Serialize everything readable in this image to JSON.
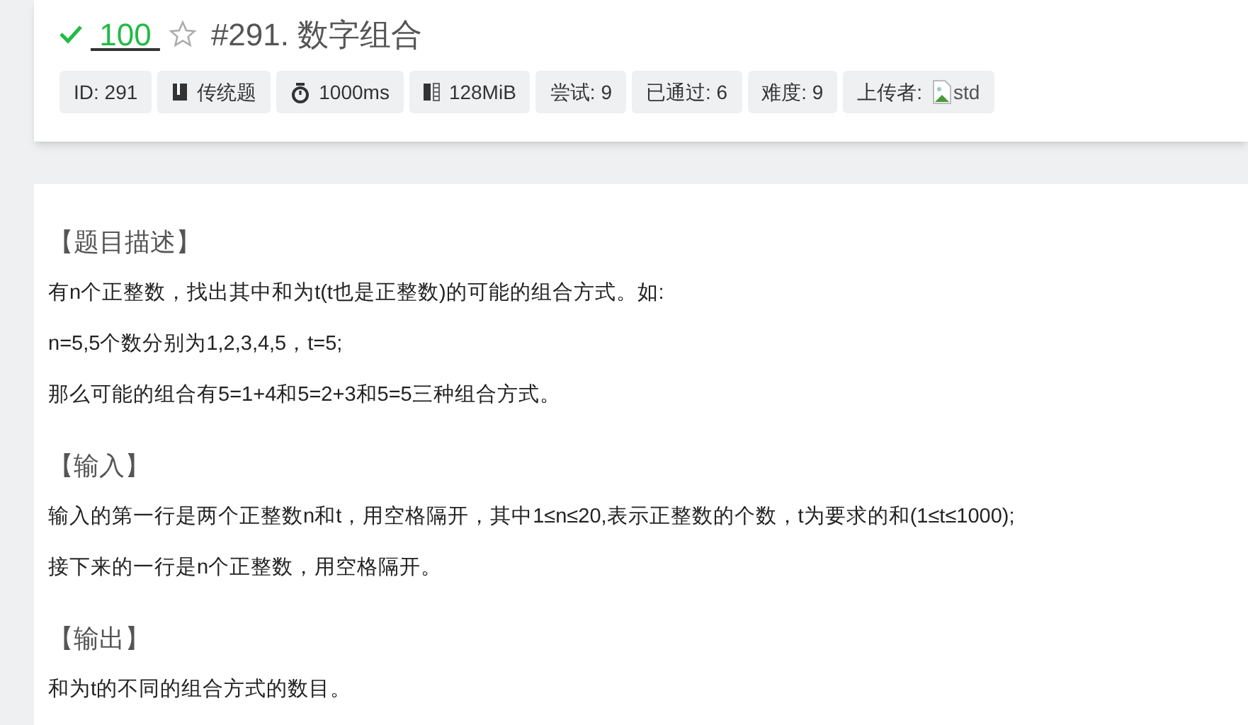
{
  "header": {
    "solved": true,
    "score": "100",
    "starred": false,
    "title": "#291. 数字组合"
  },
  "tags": [
    {
      "kind": "plain",
      "text": "ID: 291"
    },
    {
      "kind": "book",
      "text": "传统题"
    },
    {
      "kind": "timer",
      "text": "1000ms"
    },
    {
      "kind": "memory",
      "text": "128MiB"
    },
    {
      "kind": "plain",
      "text": "尝试: 9"
    },
    {
      "kind": "plain",
      "text": "已通过: 6"
    },
    {
      "kind": "plain",
      "text": "难度: 9"
    },
    {
      "kind": "uploader",
      "text": "上传者:",
      "user": "std"
    }
  ],
  "sections": [
    {
      "heading": "【题目描述】",
      "paragraphs": [
        "有n个正整数，找出其中和为t(t也是正整数)的可能的组合方式。如:",
        "n=5,5个数分别为1,2,3,4,5，t=5;",
        "那么可能的组合有5=1+4和5=2+3和5=5三种组合方式。"
      ]
    },
    {
      "heading": "【输入】",
      "paragraphs": [
        "输入的第一行是两个正整数n和t，用空格隔开，其中1≤n≤20,表示正整数的个数，t为要求的和(1≤t≤1000);",
        "接下来的一行是n个正整数，用空格隔开。"
      ]
    },
    {
      "heading": "【输出】",
      "paragraphs": [
        "和为t的不同的组合方式的数目。"
      ]
    }
  ]
}
